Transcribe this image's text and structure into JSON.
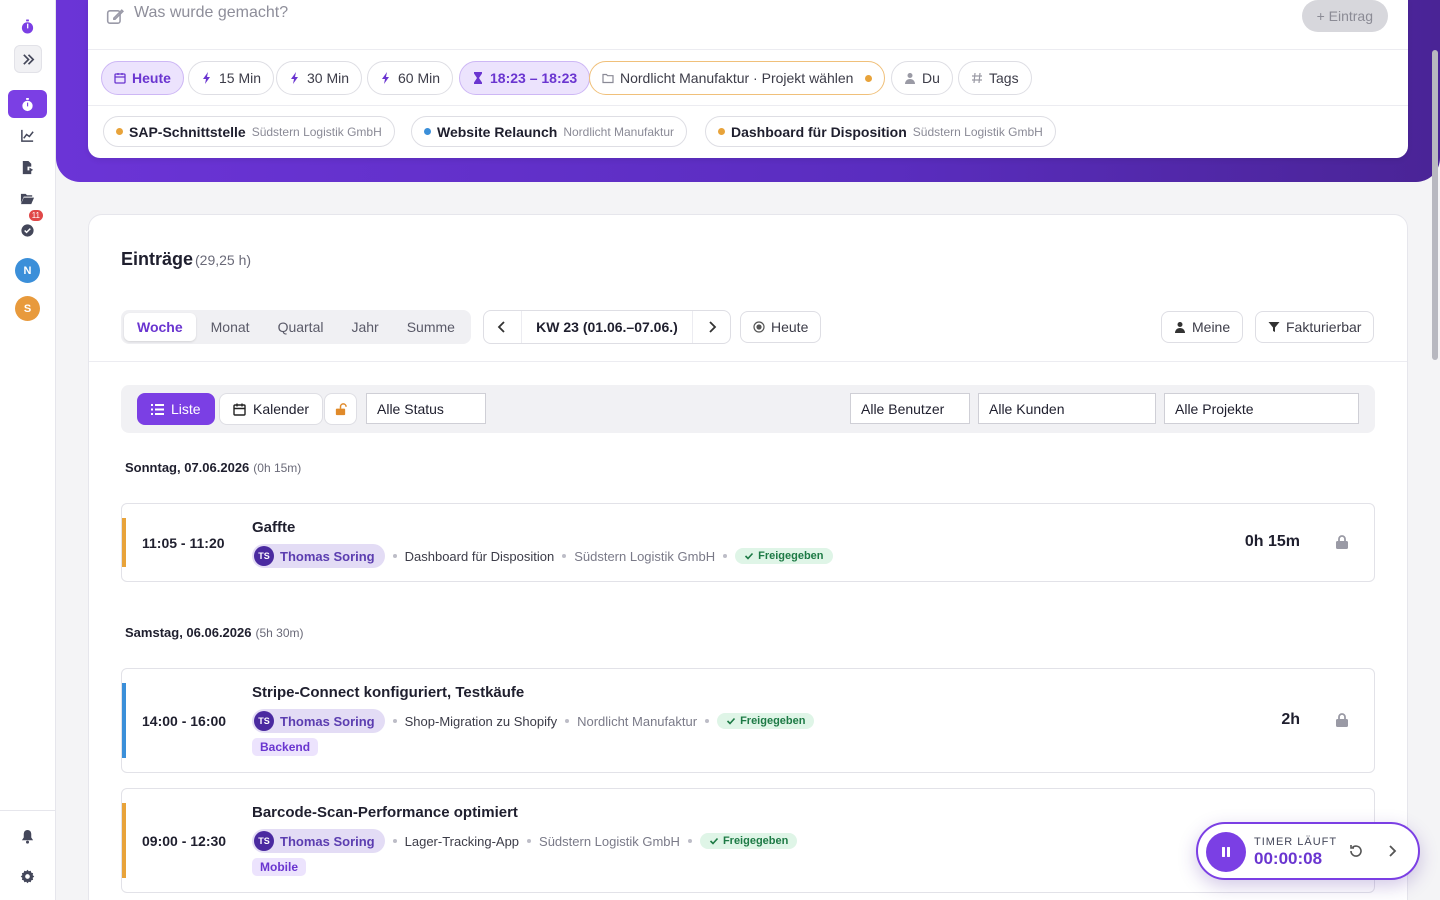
{
  "sidebar": {
    "badge_count": "11",
    "avatars": [
      {
        "initial": "N",
        "color": "#3b8fd9"
      },
      {
        "initial": "S",
        "color": "#e89a3c"
      }
    ]
  },
  "quick_entry": {
    "placeholder": "Was wurde gemacht?",
    "entry_button": "+ Eintrag",
    "chips": {
      "today": "Heute",
      "m15": "15 Min",
      "m30": "30 Min",
      "m60": "60 Min",
      "range": "18:23 – 18:23",
      "project": "Nordlicht Manufaktur · Projekt wählen",
      "user": "Du",
      "tags": "Tags"
    },
    "recent_projects": [
      {
        "name": "SAP-Schnittstelle",
        "client": "Südstern Logistik GmbH",
        "color": "#e8a33a"
      },
      {
        "name": "Website Relaunch",
        "client": "Nordlicht Manufaktur",
        "color": "#3b8fd9"
      },
      {
        "name": "Dashboard für Disposition",
        "client": "Südstern Logistik GmbH",
        "color": "#e8a33a"
      }
    ]
  },
  "entries_panel": {
    "title": "Einträge",
    "total": "(29,25 h)",
    "periods": [
      "Woche",
      "Monat",
      "Quartal",
      "Jahr",
      "Summe"
    ],
    "active_period": "Woche",
    "week_label": "KW 23 (01.06.–07.06.)",
    "today_button": "Heute",
    "mine_button": "Meine",
    "billable_button": "Fakturierbar",
    "filters": {
      "list": "Liste",
      "calendar": "Kalender",
      "status": "Alle Status",
      "users": "Alle Benutzer",
      "clients": "Alle Kunden",
      "projects": "Alle Projekte"
    }
  },
  "days": [
    {
      "label": "Sonntag, 07.06.2026",
      "sum": "(0h 15m)",
      "entries": [
        {
          "time": "11:05 - 11:20",
          "description": "Gaffte",
          "user_initials": "TS",
          "user": "Thomas Soring",
          "project": "Dashboard für Disposition",
          "client": "Südstern Logistik GmbH",
          "status": "Freigegeben",
          "duration": "0h 15m",
          "color": "#e8a33a",
          "tag": ""
        }
      ]
    },
    {
      "label": "Samstag, 06.06.2026",
      "sum": "(5h 30m)",
      "entries": [
        {
          "time": "14:00 - 16:00",
          "description": "Stripe-Connect konfiguriert, Testkäufe",
          "user_initials": "TS",
          "user": "Thomas Soring",
          "project": "Shop-Migration zu Shopify",
          "client": "Nordlicht Manufaktur",
          "status": "Freigegeben",
          "duration": "2h",
          "color": "#3b8fd9",
          "tag": "Backend"
        },
        {
          "time": "09:00 - 12:30",
          "description": "Barcode-Scan-Performance optimiert",
          "user_initials": "TS",
          "user": "Thomas Soring",
          "project": "Lager-Tracking-App",
          "client": "Südstern Logistik GmbH",
          "status": "Freigegeben",
          "duration": "",
          "color": "#e8a33a",
          "tag": "Mobile"
        }
      ]
    }
  ],
  "timer": {
    "label": "TIMER LÄUFT",
    "value": "00:00:08"
  }
}
